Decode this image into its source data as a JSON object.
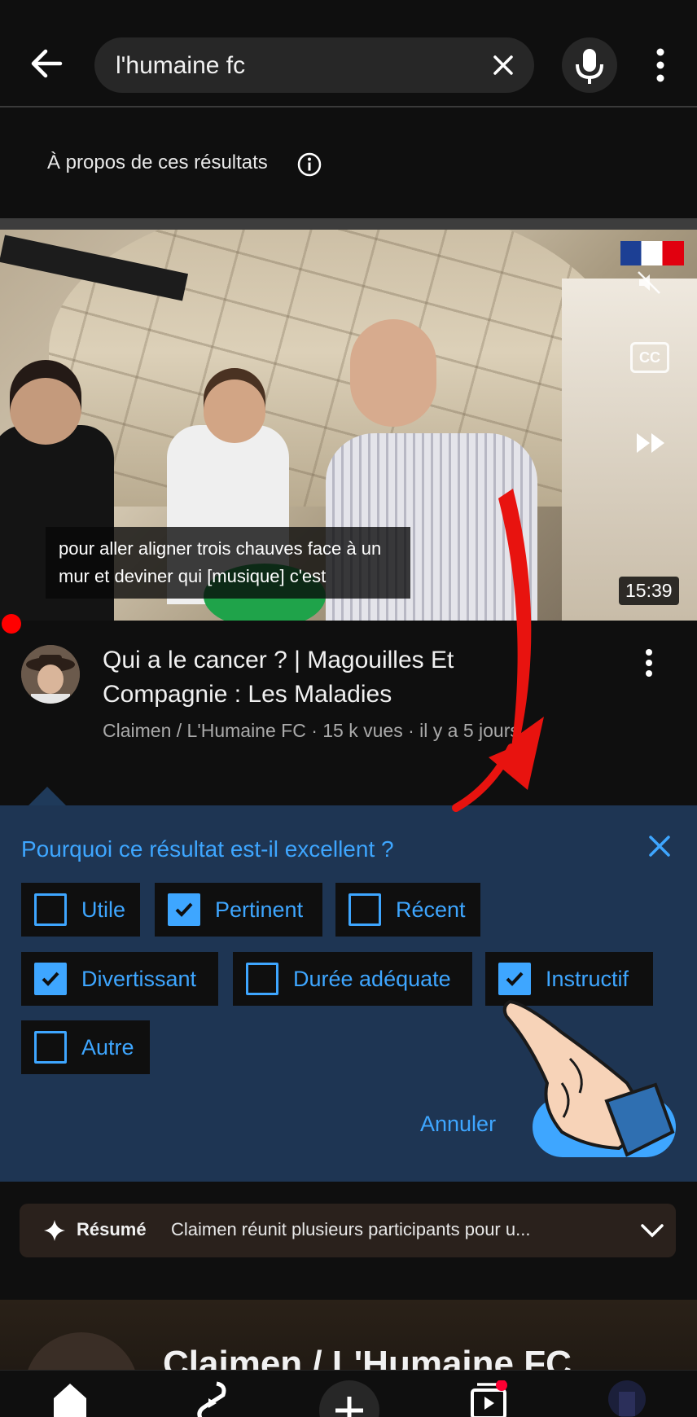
{
  "search": {
    "query": "l'humaine fc"
  },
  "about_results": "À propos de ces résultats",
  "video": {
    "caption": "pour aller aligner trois chauves face à un mur et deviner qui [musique] c'est",
    "cc_label": "CC",
    "duration": "15:39",
    "title": "Qui a le cancer ? | Magouilles Et Compagnie : Les Maladies",
    "meta": "Claimen / L'Humaine FC · 15 k vues · il y a 5 jours"
  },
  "feedback": {
    "title": "Pourquoi ce résultat est-il excellent ?",
    "options": [
      {
        "label": "Utile",
        "checked": false
      },
      {
        "label": "Pertinent",
        "checked": true
      },
      {
        "label": "Récent",
        "checked": false
      },
      {
        "label": "Divertissant",
        "checked": true
      },
      {
        "label": "Durée adéquate",
        "checked": false
      },
      {
        "label": "Instructif",
        "checked": true
      },
      {
        "label": "Autre",
        "checked": false
      }
    ],
    "cancel_label": "Annuler"
  },
  "summary": {
    "label": "Résumé",
    "text": "Claimen réunit plusieurs participants pour u..."
  },
  "next_result": {
    "title": "Claimen / L'Humaine FC"
  },
  "colors": {
    "accent": "#3ea6ff",
    "panel_bg": "#1e3553",
    "annotation_red": "#e8130f"
  },
  "icons": {
    "back": "arrow-left-icon",
    "clear": "close-icon",
    "mic": "microphone-icon",
    "more": "more-vert-icon",
    "info": "info-icon",
    "home": "home-icon",
    "shorts": "shorts-icon",
    "create": "plus-icon",
    "subscriptions": "subscriptions-icon"
  }
}
